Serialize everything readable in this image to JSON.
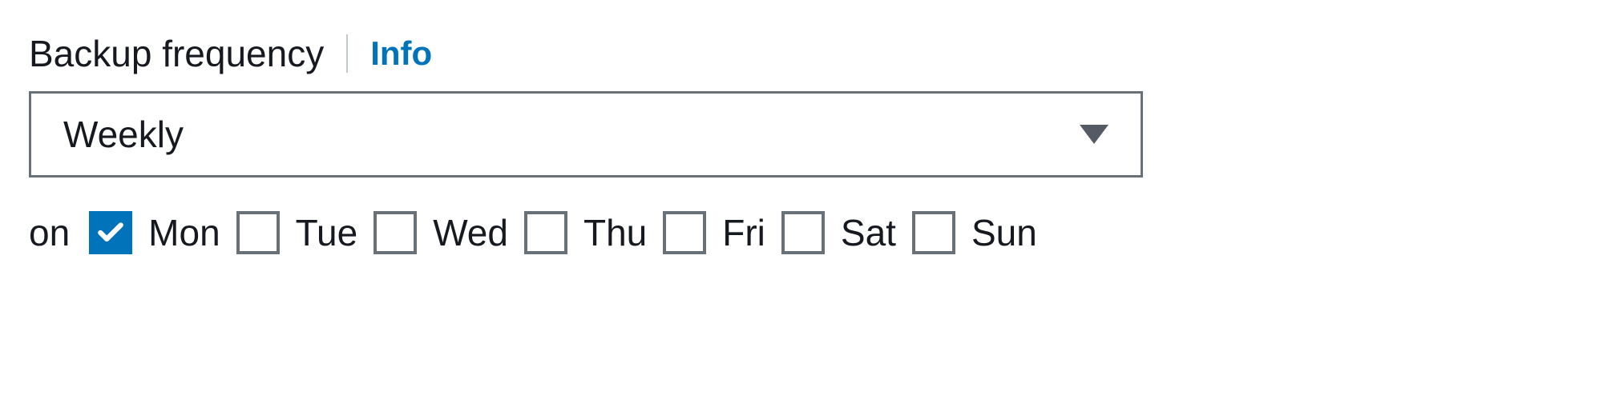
{
  "header": {
    "label": "Backup frequency",
    "info": "Info"
  },
  "select": {
    "value": "Weekly"
  },
  "days": {
    "prefix": "on",
    "items": [
      {
        "label": "Mon",
        "checked": true
      },
      {
        "label": "Tue",
        "checked": false
      },
      {
        "label": "Wed",
        "checked": false
      },
      {
        "label": "Thu",
        "checked": false
      },
      {
        "label": "Fri",
        "checked": false
      },
      {
        "label": "Sat",
        "checked": false
      },
      {
        "label": "Sun",
        "checked": false
      }
    ]
  },
  "colors": {
    "link": "#0073bb",
    "checkbox_checked": "#0073bb",
    "border": "#687078",
    "text": "#16191f"
  }
}
